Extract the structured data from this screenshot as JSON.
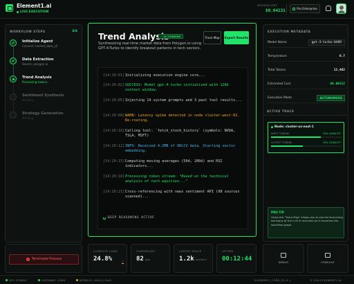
{
  "app": {
    "title": "Element1.ai",
    "status": "LIVE EXECUTION",
    "session_cost_label": "SESSION COST",
    "session_cost_value": "$0.04231",
    "plan_button": "Pro Enterprise",
    "icons": {
      "logo": "logo-icon",
      "bell": "bell-icon",
      "avatar": "avatar"
    },
    "accent_color": "#22e36a"
  },
  "sidebar": {
    "title": "WORKFLOW STEPS",
    "progress": "3/6",
    "steps": [
      {
        "title": "Initialize Agent",
        "sub": "Connect: market_data_v2",
        "state": "done"
      },
      {
        "title": "Data Extraction",
        "sub": "Source: polygon.io",
        "state": "done"
      },
      {
        "title": "Trend Analysis",
        "sub": "Processing tokens...",
        "state": "active"
      },
      {
        "title": "Sentiment Synthesis",
        "sub": "Pending",
        "state": "pending"
      },
      {
        "title": "Strategy Generation",
        "sub": "Pending",
        "state": "pending"
      }
    ]
  },
  "main": {
    "title": "Trend Analysis",
    "badge": "⚡ AI THINKING",
    "description": "Synthesizing real-time market data from Polygon.io using GPT-4-Turbo to identify breakout patterns in tech sectors.",
    "trace_button": "Trace Map",
    "export_button": "Export Results",
    "logs": [
      {
        "ts": "[14:20:01]",
        "msg": "Initializing execution engine core...",
        "type": "normal"
      },
      {
        "ts": "[14:20:02]",
        "msg": "SUCCESS: Model gpt-4-turbo initialized with 128k context window.",
        "type": "success"
      },
      {
        "ts": "[14:20:05]",
        "msg": "Injecting 14 system prompts and 3 past tool results...",
        "type": "normal"
      },
      {
        "ts": "[14:20:08]",
        "msg": "WARN: Latency spike detected in node cluster-west-02. Re-routing.",
        "type": "warn"
      },
      {
        "ts": "[14:20:10]",
        "msg": "Calling tool: `fetch_stock_history` (symbols: NVDA, TSLA, MSFT)",
        "type": "normal"
      },
      {
        "ts": "[14:20:12]",
        "msg": "INFO: Received 4.2MB of OHLCV data. Starting vector embedding.",
        "type": "info"
      },
      {
        "ts": "[14:20:15]",
        "msg": "Computing moving averages (50d, 200d) and RSI indicators...",
        "type": "normal"
      },
      {
        "ts": "[14:20:18]",
        "msg": "Processing token stream: \"Based on the technical analysis of tech equities...\"",
        "type": "stream"
      },
      {
        "ts": "[14:20:21]",
        "msg": "Cross-referencing with news sentiment API (98 sources scanned)...",
        "type": "normal"
      }
    ],
    "status": "DEEP REASONING ACTIVE"
  },
  "metadata": {
    "title": "EXECUTION METADATA",
    "rows": [
      {
        "k": "Model Name",
        "v": "gpt-4-turbo-0409",
        "style": "model"
      },
      {
        "k": "Temperature",
        "v": "0.7",
        "style": "plain"
      },
      {
        "k": "Total Tokens",
        "v": "12,482",
        "style": "plain"
      },
      {
        "k": "Estimated Cost",
        "v": "$0.00312",
        "style": "green"
      },
      {
        "k": "Execution Mode",
        "v": "AUTONOMOUS",
        "style": "badge"
      }
    ]
  },
  "trace": {
    "title": "ACTIVE TRACE",
    "node": "Node: cluster-us-east-1",
    "input_label": "INPUT TOKENS",
    "input_cap": "70% CAPACITY",
    "input_fraction": 0.7,
    "output_label": "OUTPUT TOKENS",
    "output_cap": "70% CAPACITY",
    "output_fraction": 0.45,
    "tip_title": "PRO TIP",
    "tip_text": "Using the \"Trace Map\" allows you to see the branching decisions of the LLM in real-time as it traverses the workflow graph."
  },
  "bottom": {
    "terminate": "Terminate Process",
    "stats": [
      {
        "label": "COMPUTE LOAD",
        "value": "24.8%",
        "unit": ""
      },
      {
        "label": "TOKENS/SEC",
        "value": "82",
        "unit": "avg"
      },
      {
        "label": "LATENT SPACE",
        "value": "1.2k",
        "unit": "vectors"
      },
      {
        "label": "UPTIME",
        "value": "00:12:44",
        "unit": ""
      }
    ],
    "compute_load_fraction": 0.248,
    "tools": [
      {
        "name": "DEBUG",
        "icon": "debug-icon"
      },
      {
        "name": "CONSOLE",
        "icon": "console-icon"
      }
    ]
  },
  "footer": {
    "api": "API: STABLE",
    "gateway": "GATEWAY: 12MS",
    "models": "MODELS: HIGH_LOAD",
    "version": "ELEMENT1_CORE_V2.4.1",
    "copyright": "© 2024 ELEMENT1.AI"
  }
}
